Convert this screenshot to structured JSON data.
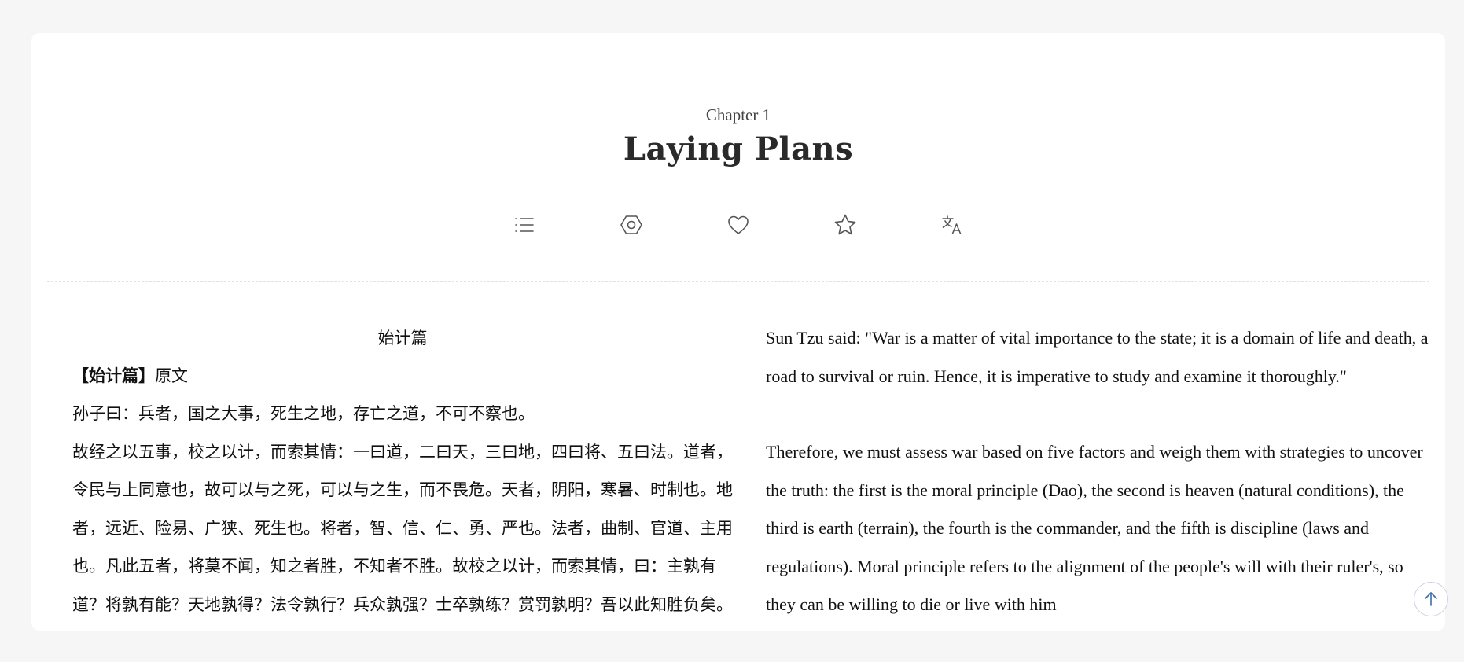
{
  "chapter": {
    "label": "Chapter 1",
    "title": "Laying Plans"
  },
  "toolbar": {
    "items": [
      {
        "name": "contents-list-icon"
      },
      {
        "name": "settings-hexagon-icon"
      },
      {
        "name": "heart-icon"
      },
      {
        "name": "star-icon"
      },
      {
        "name": "translate-icon"
      }
    ]
  },
  "original": {
    "section_title": "始计篇",
    "subheading_bold": "【始计篇】",
    "subheading_rest": "原文",
    "paragraphs": [
      "孙子曰：兵者，国之大事，死生之地，存亡之道，不可不察也。",
      "故经之以五事，校之以计，而索其情：一曰道，二曰天，三曰地，四曰将、五曰法。道者，令民与上同意也，故可以与之死，可以与之生，而不畏危。天者，阴阳，寒暑、时制也。地者，远近、险易、广狭、死生也。将者，智、信、仁、勇、严也。法者，曲制、官道、主用也。凡此五者，将莫不闻，知之者胜，不知者不胜。故校之以计，而索其情，曰：主孰有道？将孰有能？天地孰得？法令孰行？兵众孰强？士卒孰练？赏罚孰明？吾以此知胜负矣。"
    ]
  },
  "translation": {
    "paragraphs": [
      "Sun Tzu said: \"War is a matter of vital importance to the state; it is a domain of life and death, a road to survival or ruin. Hence, it is imperative to study and examine it thoroughly.\"",
      "Therefore, we must assess war based on five factors and weigh them with strategies to uncover the truth: the first is the moral principle (Dao), the second is heaven (natural conditions), the third is earth (terrain), the fourth is the commander, and the fifth is discipline (laws and regulations). Moral principle refers to the alignment of the people's will with their ruler's, so they can be willing to die or live with him"
    ]
  },
  "colors": {
    "background": "#f6f6f6",
    "card": "#ffffff",
    "icon": "#555555",
    "scroll_ring": "#c8d4e4",
    "scroll_arrow": "#3a6ea5"
  }
}
